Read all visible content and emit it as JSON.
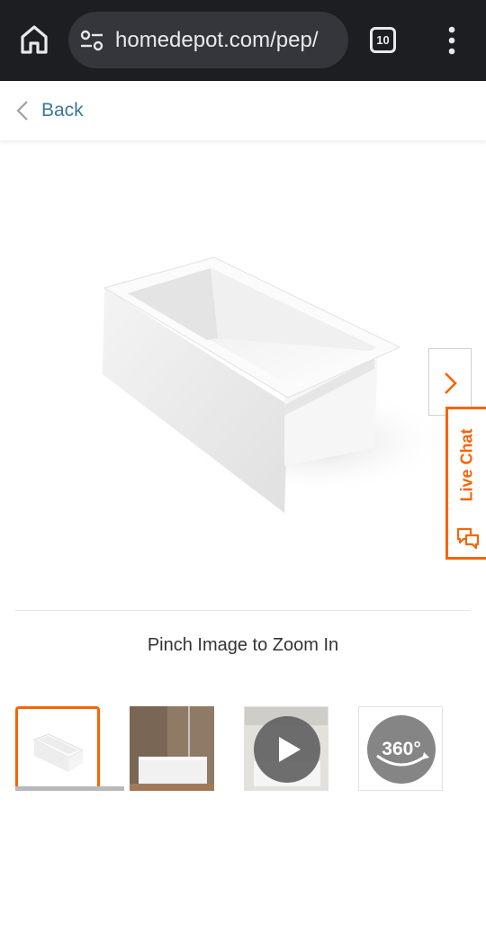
{
  "browser": {
    "url": "homedepot.com/pep/",
    "tab_count": "10"
  },
  "nav": {
    "back_label": "Back"
  },
  "gallery": {
    "zoom_hint": "Pinch Image to Zoom In",
    "thumbnails": [
      {
        "kind": "image",
        "selected": true
      },
      {
        "kind": "image",
        "selected": false
      },
      {
        "kind": "video",
        "selected": false
      },
      {
        "kind": "360",
        "label": "360°",
        "selected": false
      }
    ]
  },
  "live_chat": {
    "label": "Live Chat"
  },
  "colors": {
    "accent": "#f96302",
    "link": "#3e7697",
    "chrome": "#1d1e22"
  }
}
